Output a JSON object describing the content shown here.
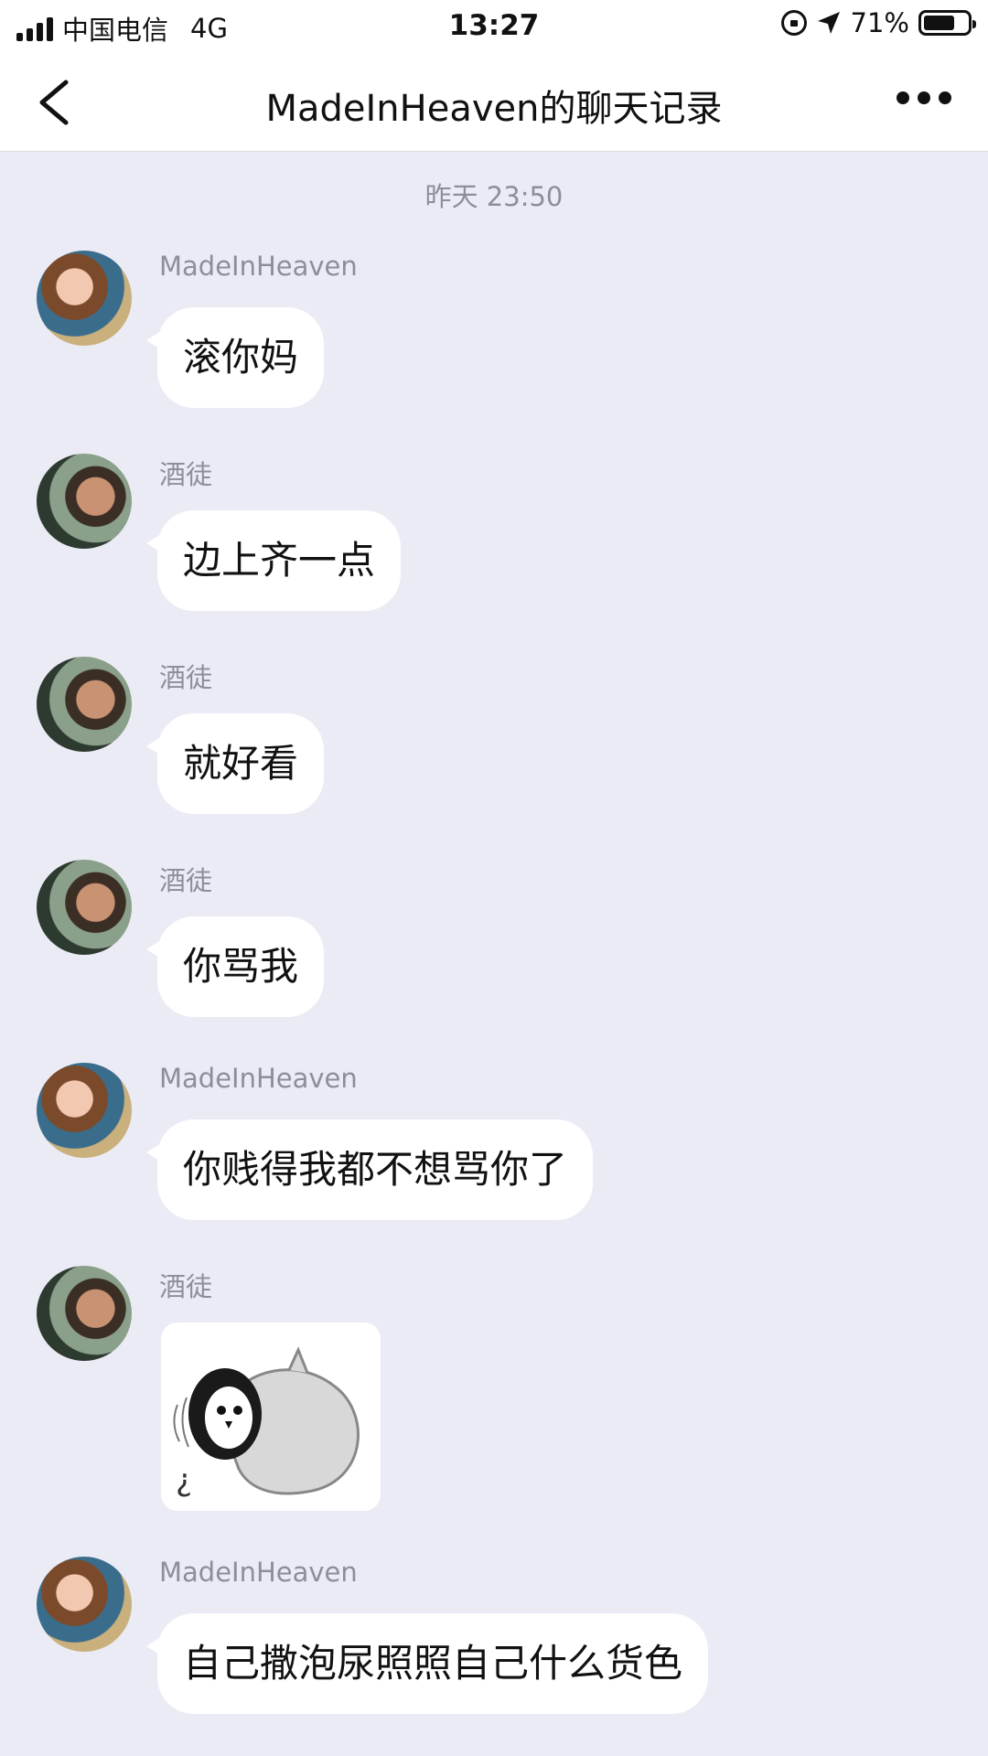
{
  "status_bar": {
    "carrier": "中国电信",
    "network": "4G",
    "time": "13:27",
    "battery": "71%",
    "battery_level": 0.71
  },
  "nav": {
    "title": "MadeInHeaven的聊天记录",
    "back_icon": "chevron-left-icon",
    "more_icon": "more-dots-icon"
  },
  "timestamp": "昨天 23:50",
  "messages": [
    {
      "sender": "MadeInHeaven",
      "text": "滚你妈"
    },
    {
      "sender": "酒徒",
      "text": "边上齐一点"
    },
    {
      "sender": "酒徒",
      "text": "就好看"
    },
    {
      "sender": "酒徒",
      "text": "你骂我"
    },
    {
      "sender": "MadeInHeaven",
      "text": "你贱得我都不想骂你了"
    },
    {
      "sender": "酒徒",
      "sticker_glyph": "¿"
    },
    {
      "sender": "MadeInHeaven",
      "text": "自己撒泡尿照照自己什么货色"
    }
  ],
  "colors": {
    "chat_background": "#ebebf5",
    "bubble_background": "#ffffff",
    "secondary_text": "#8e8e98"
  }
}
